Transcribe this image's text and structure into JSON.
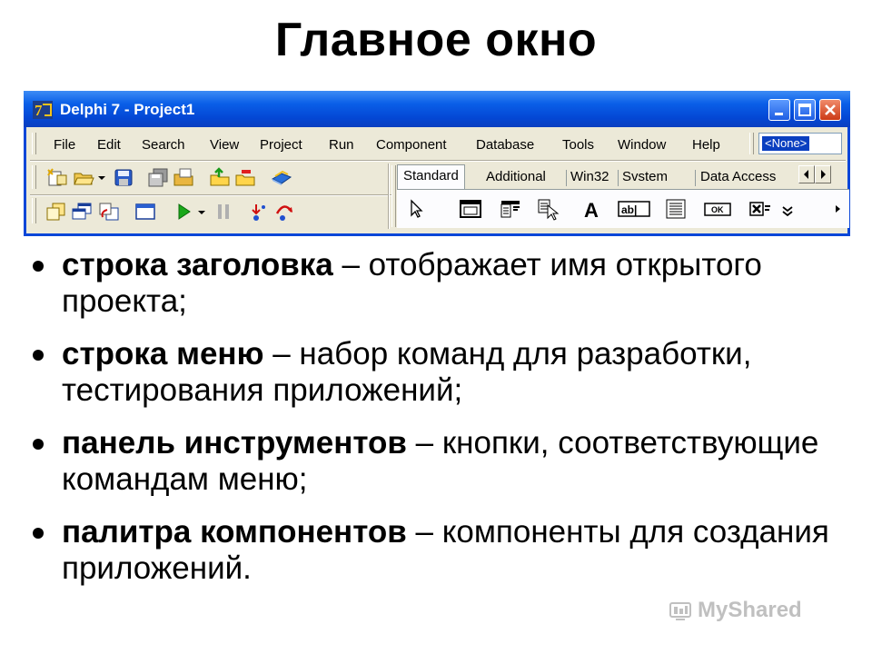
{
  "slide": {
    "title": "Главное окно"
  },
  "window": {
    "title": "Delphi 7 - Project1",
    "app_icon": "delphi-7-icon",
    "controls": [
      "minimize-icon",
      "maximize-icon",
      "close-icon"
    ],
    "menu": [
      "File",
      "Edit",
      "Search",
      "View",
      "Project",
      "Run",
      "Component",
      "Database",
      "Tools",
      "Window",
      "Help"
    ],
    "config_combo": "<None>",
    "toolbar_row1": [
      "new-items-icon",
      "open-icon",
      "dropdown-arrow-icon",
      "save-icon",
      "save-all-icon",
      "open-project-icon",
      "add-file-icon",
      "remove-file-icon",
      "help-book-icon"
    ],
    "toolbar_row2": [
      "view-unit-icon",
      "view-form-icon",
      "toggle-form-unit-icon",
      "new-form-icon",
      "run-icon",
      "dropdown-arrow-icon",
      "pause-icon",
      "trace-into-icon",
      "step-over-icon"
    ],
    "palette_tabs": [
      "Standard",
      "Additional",
      "Win32",
      "Svstem",
      "Data Access"
    ],
    "palette_components": [
      "pointer-icon",
      "frame-icon",
      "mainmenu-icon",
      "popupmenu-icon",
      "label-icon",
      "edit-icon",
      "memo-icon",
      "button-icon",
      "checkbox-icon",
      "more-icon",
      "scroll-right-icon"
    ],
    "component_text": {
      "label": "A",
      "edit": "ab|",
      "button": "OK"
    },
    "colors": {
      "titlebar": "#0a5fe8",
      "face": "#ece9d8",
      "run": "#1aa81a"
    }
  },
  "bullets": [
    {
      "term": "строка заголовка",
      "text": " – отображает имя открытого проекта;"
    },
    {
      "term": "строка меню",
      "text": " – набор команд для разработки, тестирования приложений;"
    },
    {
      "term": "панель инструментов",
      "text": " – кнопки, соответствующие командам меню;"
    },
    {
      "term": "палитра компонентов",
      "text": " – компоненты для создания приложений."
    }
  ],
  "watermark": "MyShared"
}
